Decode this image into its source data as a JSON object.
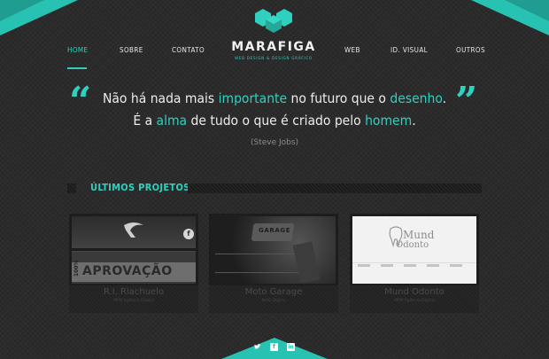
{
  "nav": {
    "left": [
      "HOME",
      "SOBRE",
      "CONTATO"
    ],
    "right": [
      "WEB",
      "ID. VISUAL",
      "OUTROS"
    ]
  },
  "logo": {
    "name": "MARAFIGA",
    "tagline": "WEB DESIGN & DESIGN GRÁFICO"
  },
  "quote": {
    "line1_a": "Não há nada mais ",
    "line1_hl1": "importante",
    "line1_b": " no futuro que o ",
    "line1_hl2": "desenho",
    "line1_c": ".",
    "line2_a": "É a ",
    "line2_hl1": "alma",
    "line2_b": " de tudo o que é criado pelo ",
    "line2_hl2": "homem",
    "line2_c": ".",
    "author": "(Steve Jobs)"
  },
  "section": {
    "title": "ÚLTIMOS PROJETOS"
  },
  "projects": [
    {
      "title": "R.I. Riachuelo",
      "subtitle": "MPN Agência Digital",
      "banner": "APROVAÇÃO",
      "banner_prefix": "100%"
    },
    {
      "title": "Moto Garage",
      "subtitle": "MAG Digital",
      "badge": "GARAGE"
    },
    {
      "title": "Mund Odonto",
      "subtitle": "MPN Agência Digital",
      "logo_top": "Mund",
      "logo_bottom": "Odonto"
    }
  ],
  "social": [
    "twitter",
    "facebook",
    "linkedin"
  ],
  "colors": {
    "accent": "#2fd0bf",
    "accent_dark": "#1f9d91",
    "background": "#2b2b2b"
  }
}
